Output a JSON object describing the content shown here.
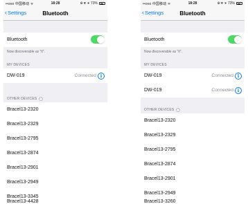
{
  "status_bar": {
    "carrier": "••ooo 中国移动 ᯤ",
    "time": "18:28",
    "indicators": "⊕ ♥ ∗ 73%"
  },
  "nav": {
    "back_label": "Settings",
    "title": "Bluetooth"
  },
  "bluetooth": {
    "label": "Bluetooth",
    "enabled": true,
    "toggle_color": "#4cd964"
  },
  "discoverable_note": "Now discoverable as \"tl\".",
  "my_devices_header": "MY DEVICES",
  "other_devices_header": "OTHER DEVICES",
  "left_screen": {
    "my_devices": [
      {
        "name": "DW-019",
        "status": "Connected"
      }
    ],
    "other_devices": [
      "Bracel13-2320",
      "Bracel13-2329",
      "Bracel13-2795",
      "Bracel13-2874",
      "Bracel13-2901",
      "Bracel13-2949",
      "Bracel13-3345",
      "Bracel13-4428"
    ]
  },
  "right_screen": {
    "my_devices": [
      {
        "name": "DW-019",
        "status": "Connected"
      },
      {
        "name": "DW-019",
        "status": "Connected"
      }
    ],
    "other_devices": [
      "Bracel13-2320",
      "Bracel13-2329",
      "Bracel13-2795",
      "Bracel13-2874",
      "Bracel13-2901",
      "Bracel13-2949",
      "Bracel13-3260"
    ]
  },
  "colors": {
    "accent": "#007aff",
    "background": "#efeff4",
    "secondary_text": "#8e8e93"
  }
}
